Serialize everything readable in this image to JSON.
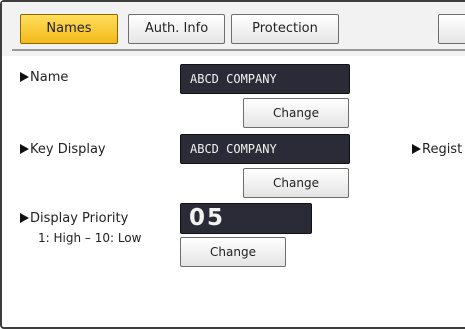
{
  "tabs": [
    {
      "label": "Names",
      "active": true
    },
    {
      "label": "Auth. Info",
      "active": false
    },
    {
      "label": "Protection",
      "active": false
    },
    {
      "label": "",
      "active": false
    }
  ],
  "fields": {
    "name": {
      "label": "Name",
      "value": "ABCD COMPANY",
      "button": "Change"
    },
    "key_display": {
      "label": "Key Display",
      "value": "ABCD COMPANY",
      "button": "Change"
    },
    "registration": {
      "label": "Regist"
    },
    "display_priority": {
      "label": "Display Priority",
      "hint": "1: High – 10: Low",
      "value": "05",
      "button": "Change"
    }
  },
  "colors": {
    "active_tab": "#f7c62b",
    "display_bg": "#2a2b36"
  }
}
